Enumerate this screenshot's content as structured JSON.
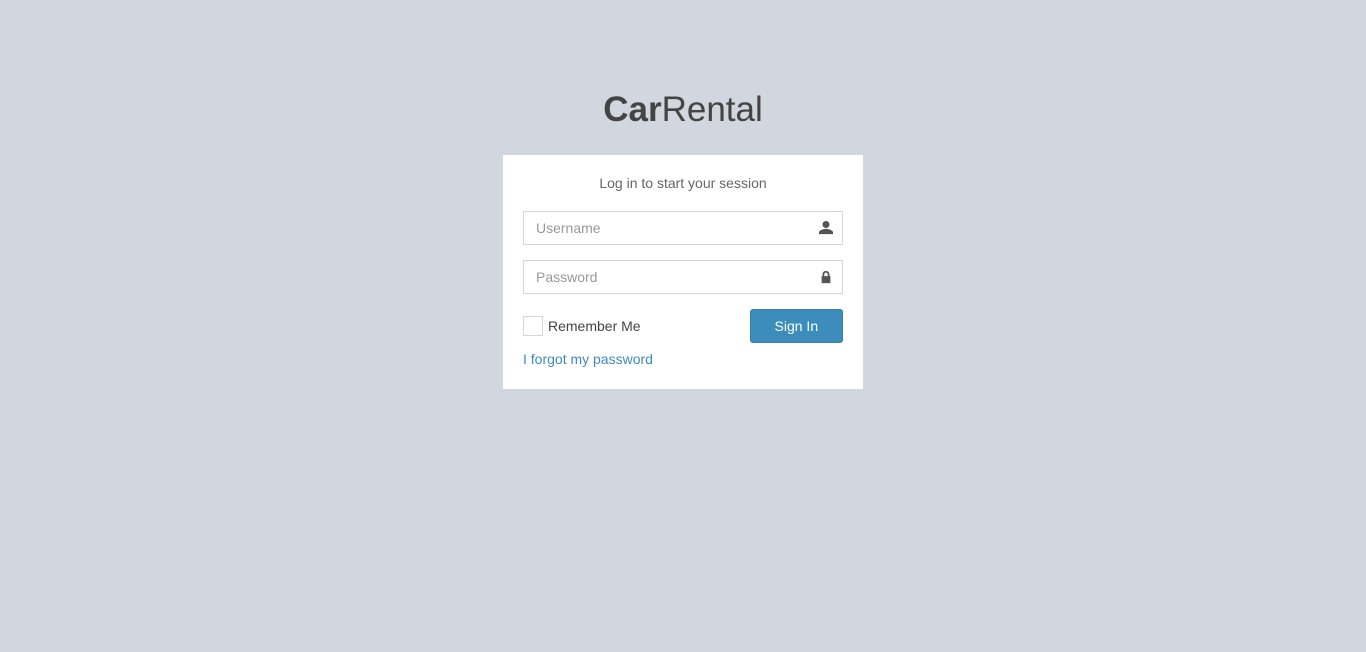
{
  "logo": {
    "bold": "Car",
    "light": "Rental"
  },
  "login": {
    "message": "Log in to start your session",
    "username_placeholder": "Username",
    "password_placeholder": "Password",
    "remember_label": "Remember Me",
    "signin_label": "Sign In",
    "forgot_link": "I forgot my password"
  }
}
